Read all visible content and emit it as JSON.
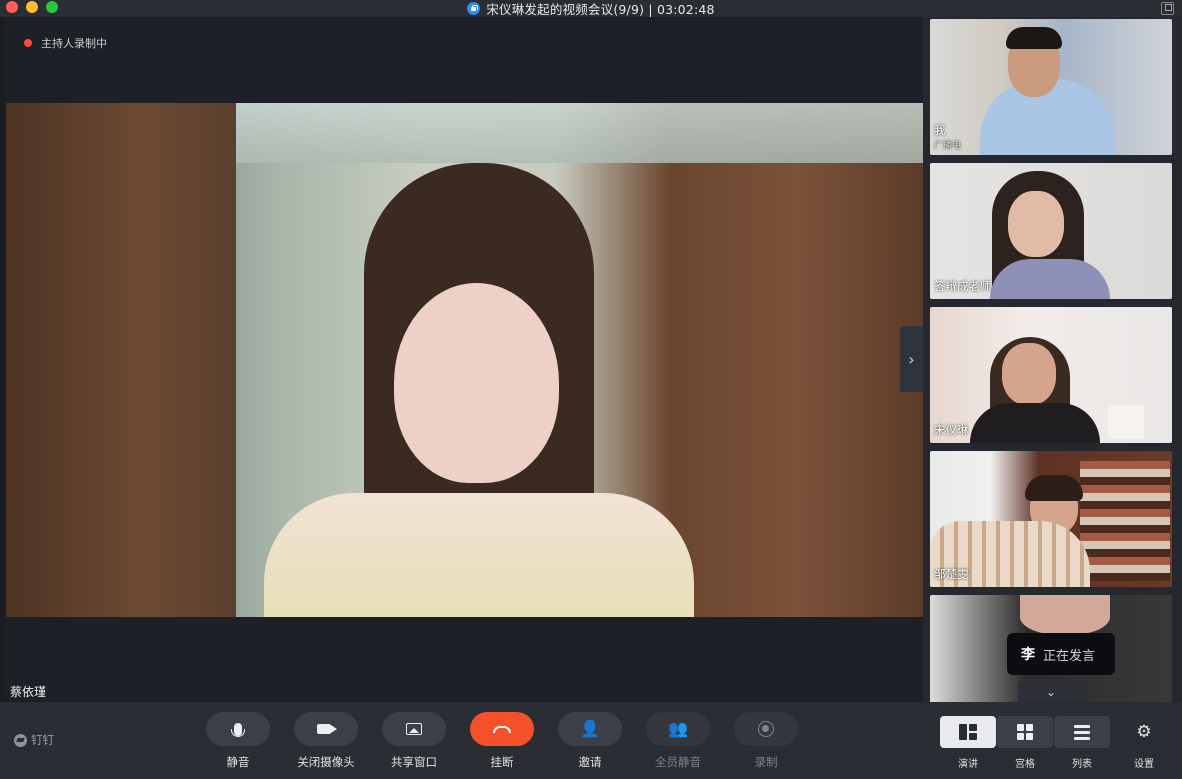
{
  "window": {
    "title": "宋仪琳发起的视频会议(9/9) | 03:02:48"
  },
  "stage": {
    "recording_status": "主持人录制中",
    "main_speaker_name": "蔡依瑾"
  },
  "participants": [
    {
      "name": "我",
      "subtitle": "广播电"
    },
    {
      "name": "答辩成老师"
    },
    {
      "name": "宋仪琳"
    },
    {
      "name": "邹楚雯"
    },
    {
      "name": ""
    }
  ],
  "speaking": {
    "initial": "李",
    "text": "正在发言"
  },
  "brand": {
    "label": "钉钉"
  },
  "toolbar": {
    "mute": "静音",
    "camera_off": "关闭摄像头",
    "share_window": "共享窗口",
    "hangup": "挂断",
    "invite": "邀请",
    "mute_all": "全员静音",
    "record": "录制"
  },
  "views": {
    "speaker": "演讲",
    "grid": "宫格",
    "list": "列表",
    "settings": "设置"
  },
  "colors": {
    "hangup": "#f4502a",
    "recording_dot": "#ff4a3d",
    "lock": "#2f8cf0"
  }
}
